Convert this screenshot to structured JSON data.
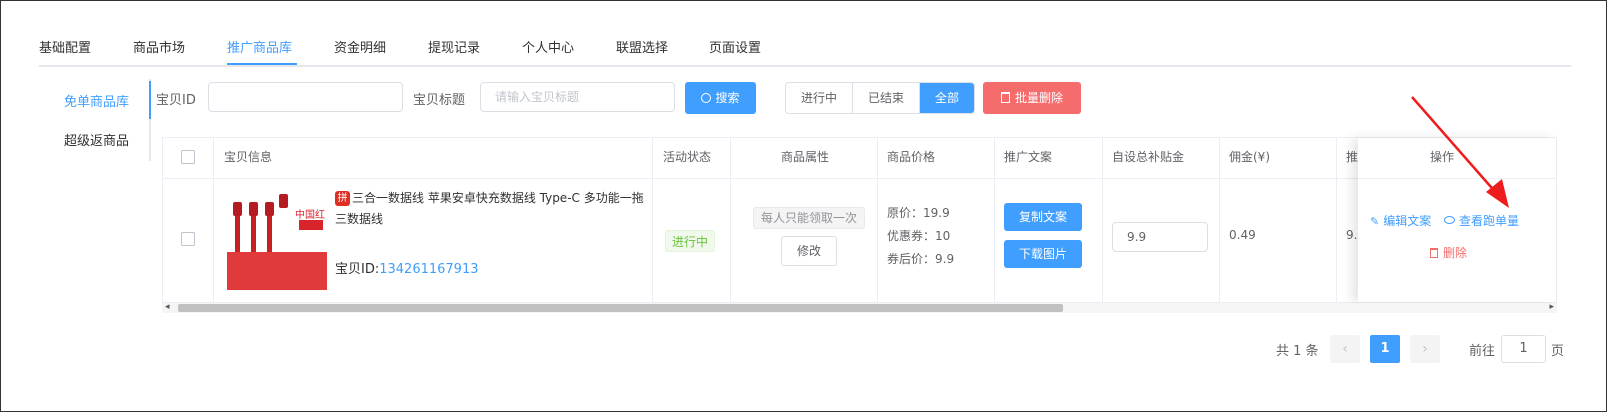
{
  "top_tabs": [
    "基础配置",
    "商品市场",
    "推广商品库",
    "资金明细",
    "提现记录",
    "个人中心",
    "联盟选择",
    "页面设置"
  ],
  "side_tabs": [
    "免单商品库",
    "超级返商品"
  ],
  "filters": {
    "id_label": "宝贝ID",
    "id_value": "",
    "title_label": "宝贝标题",
    "title_placeholder": "请输入宝贝标题",
    "search_label": "搜索",
    "status_options": [
      "进行中",
      "已结束",
      "全部"
    ],
    "status_selected": "全部",
    "batch_delete_label": "批量删除"
  },
  "table": {
    "headers": {
      "info": "宝贝信息",
      "status": "活动状态",
      "attr": "商品属性",
      "price": "商品价格",
      "copy": "推广文案",
      "subsidy": "自设总补贴金",
      "commission": "佣金(¥)",
      "promo": "推",
      "ops": "操作"
    },
    "row": {
      "image_brand": "中国红",
      "platform_badge": "拼",
      "title": "三合一数据线 苹果安卓快充数据线 Type-C 多功能一拖三数据线",
      "id_label": "宝贝ID:",
      "id_value": "134261167913",
      "status": "进行中",
      "attr_tag": "每人只能领取一次",
      "edit_attr": "修改",
      "price_original": "原价：19.9",
      "price_coupon": "优惠券：10",
      "price_after": "券后价：9.9",
      "copy_btn": "复制文案",
      "download_btn": "下载图片",
      "subsidy_value": "9.9",
      "commission": "0.49",
      "promo_partial": "9.",
      "op_edit": "编辑文案",
      "op_view": "查看跑单量",
      "op_delete": "删除"
    }
  },
  "pagination": {
    "total": "共 1 条",
    "current": "1",
    "goto_prefix": "前往",
    "goto_value": "1",
    "goto_suffix": "页"
  },
  "colors": {
    "primary": "#409eff",
    "danger": "#f56c6c",
    "success": "#67c23a",
    "annotation_arrow": "#ee1c1c"
  }
}
